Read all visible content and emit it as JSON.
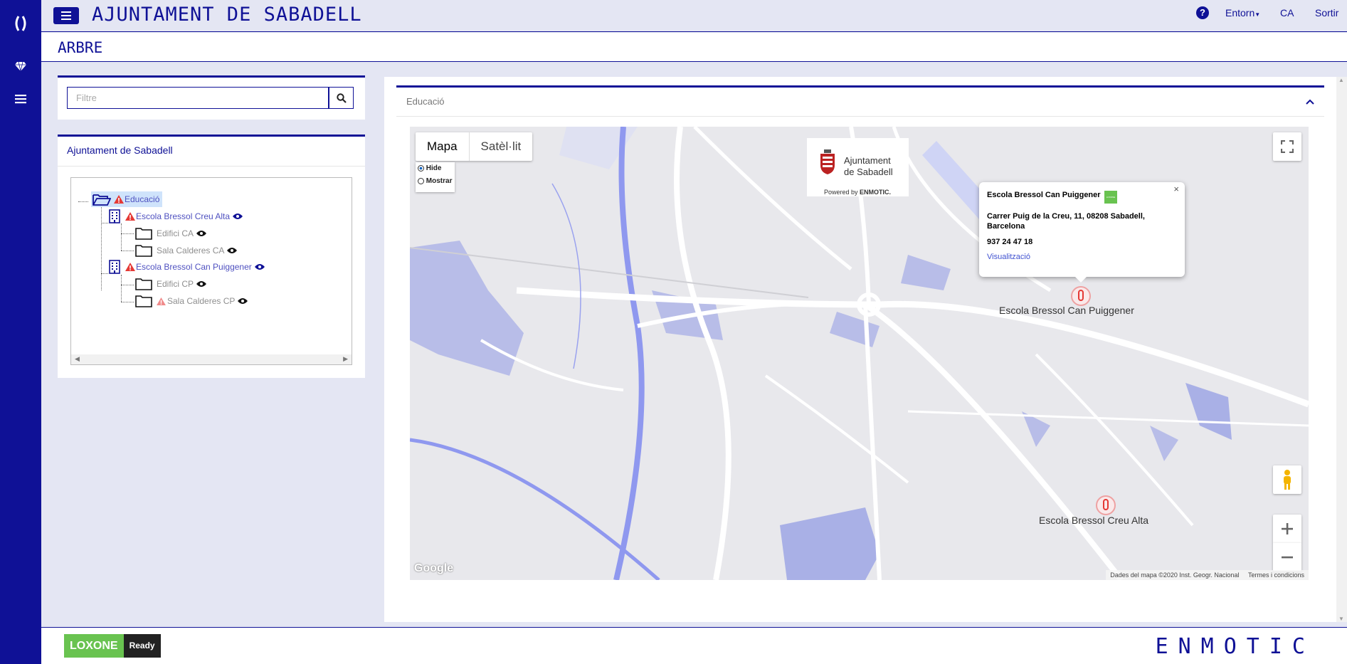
{
  "header": {
    "title": "AJUNTAMENT DE SABADELL",
    "help_label": "?",
    "env_label": "Entorn",
    "lang_label": "CA",
    "logout_label": "Sortir"
  },
  "subheader": {
    "title": "ARBRE"
  },
  "filter": {
    "placeholder": "Filtre"
  },
  "tree_panel": {
    "title": "Ajuntament de Sabadell",
    "nodes": [
      {
        "label": "Educació",
        "alert": true,
        "icon": "folder-open-icon"
      },
      {
        "label": "Escola Bressol Creu Alta",
        "alert": true,
        "icon": "building-icon"
      },
      {
        "label": "Edifici CA",
        "alert": false,
        "icon": "folder-icon"
      },
      {
        "label": "Sala Calderes CA",
        "alert": false,
        "icon": "folder-icon"
      },
      {
        "label": "Escola Bressol Can Puiggener",
        "alert": true,
        "icon": "building-icon"
      },
      {
        "label": "Edifici CP",
        "alert": false,
        "icon": "folder-icon"
      },
      {
        "label": "Sala Calderes CP",
        "alert": true,
        "icon": "folder-icon"
      }
    ]
  },
  "map_card": {
    "title": "Educació",
    "map_types": [
      "Mapa",
      "Satèl·lit"
    ],
    "radio_options": [
      "Hide",
      "Mostrar"
    ],
    "logo": {
      "line1": "Ajuntament",
      "line2": "de Sabadell",
      "powered": "Powered by",
      "brand": "ENMOTIC."
    },
    "popup": {
      "title": "Escola Bressol Can Puiggener",
      "address": "Carrer Puig de la Creu, 11, 08208 Sabadell, Barcelona",
      "phone": "937 24 47 18",
      "link": "Visualització",
      "badge": "LOXONE"
    },
    "markers": [
      "Escola Bressol Can Puiggener",
      "Escola Bressol Creu Alta"
    ],
    "google_label": "Google",
    "attribution": "Dades del mapa ©2020 Inst. Geogr. Nacional",
    "terms": "Termes i condicions"
  },
  "footer": {
    "loxone_label": "LOXONE",
    "ready_label": "Ready",
    "brand": "ENMOTIC"
  },
  "colors": {
    "brand": "#0f1196",
    "background": "#e4e6f3",
    "alert": "#e53935"
  }
}
